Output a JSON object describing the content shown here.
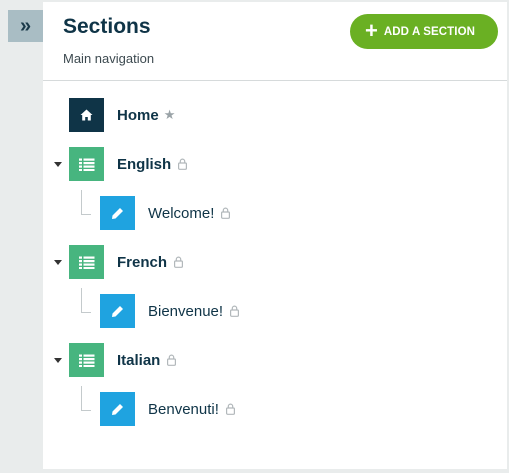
{
  "rail": {
    "expand_icon": "double-chevron-right-icon",
    "glyph": "»"
  },
  "header": {
    "title": "Sections",
    "subtitle": "Main navigation",
    "add_button": {
      "label": "ADD A SECTION",
      "icon": "plus-icon",
      "glyph": "+"
    }
  },
  "tree": {
    "home": {
      "label": "Home",
      "icon": "home-icon",
      "star": "★"
    },
    "sections": [
      {
        "label": "English",
        "icon": "list-icon",
        "page": {
          "label": "Welcome!",
          "icon": "pencil-icon"
        }
      },
      {
        "label": "French",
        "icon": "list-icon",
        "page": {
          "label": "Bienvenue!",
          "icon": "pencil-icon"
        }
      },
      {
        "label": "Italian",
        "icon": "list-icon",
        "page": {
          "label": "Benvenuti!",
          "icon": "pencil-icon"
        }
      }
    ]
  },
  "colors": {
    "home": "#0f3447",
    "section": "#47b57f",
    "page": "#1fa3e0",
    "add_button": "#6ab023"
  }
}
